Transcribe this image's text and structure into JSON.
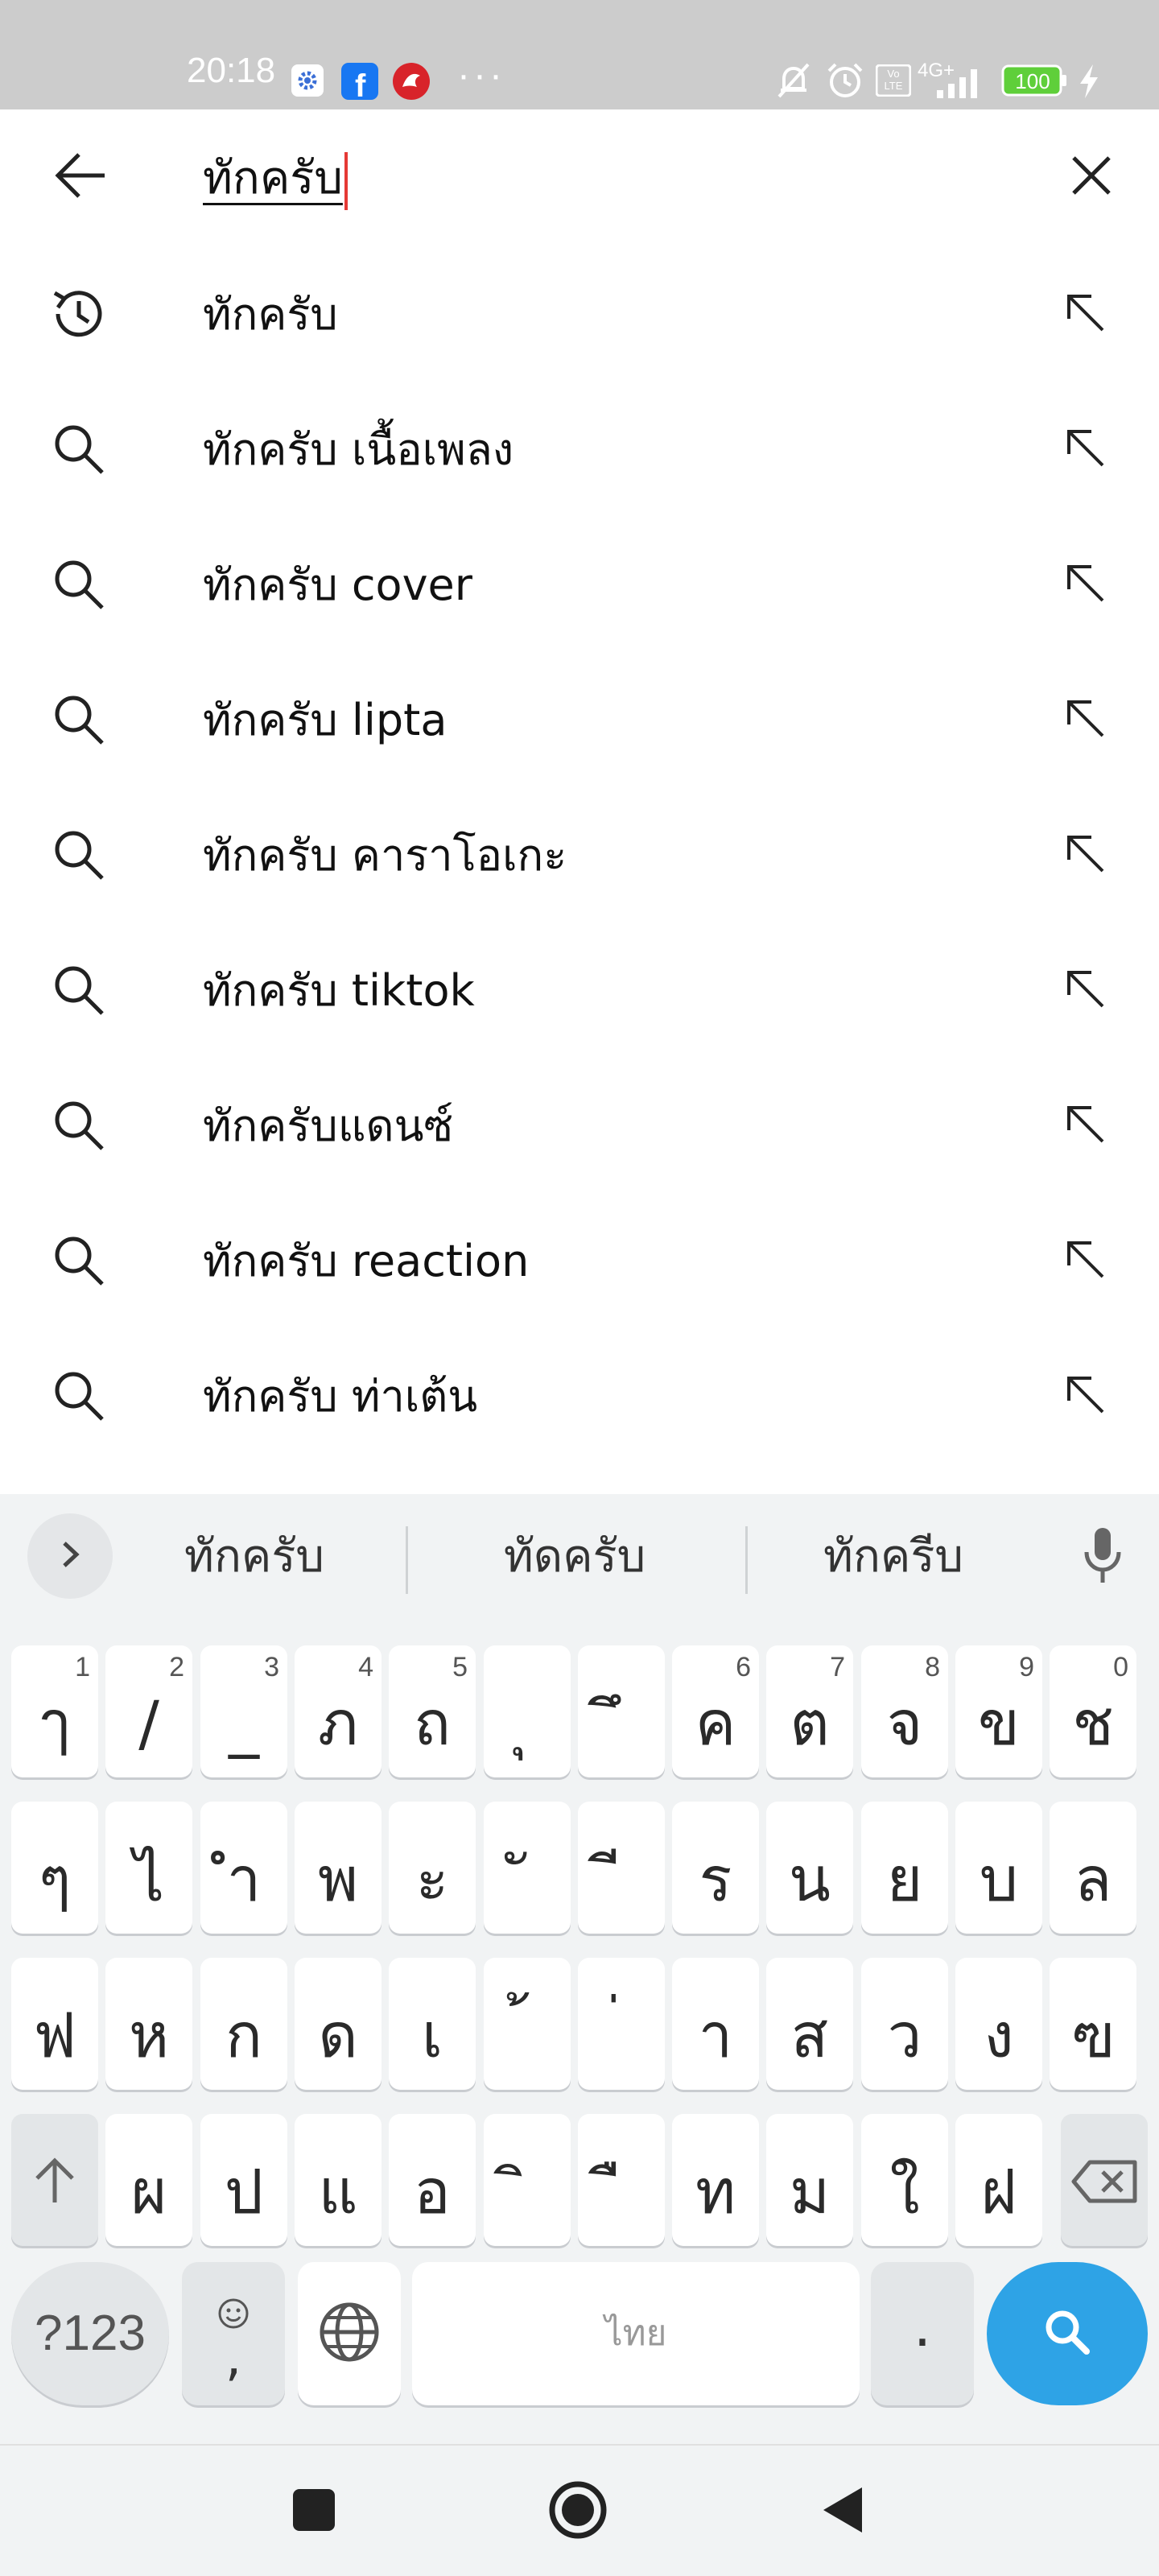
{
  "status_bar": {
    "time": "20:18",
    "network": "4G+",
    "volte": "Vo LTE",
    "battery": "100",
    "icons": [
      "settings-gear-icon",
      "facebook-icon",
      "phoenix-app-icon",
      "more-dots-icon",
      "bell-muted-icon",
      "alarm-icon",
      "signal-icon",
      "battery-icon",
      "charging-bolt-icon"
    ],
    "facebook_letter": "f",
    "dots": "···"
  },
  "search": {
    "query": "ทักครับ",
    "back_icon": "arrow-left-icon",
    "clear_icon": "close-icon"
  },
  "suggestions": [
    {
      "text": "ทักครับ",
      "icon": "history-icon"
    },
    {
      "text": "ทักครับ เนื้อเพลง",
      "icon": "search-icon"
    },
    {
      "text": "ทักครับ cover",
      "icon": "search-icon"
    },
    {
      "text": "ทักครับ lipta",
      "icon": "search-icon"
    },
    {
      "text": "ทักครับ คาราโอเกะ",
      "icon": "search-icon"
    },
    {
      "text": "ทักครับ tiktok",
      "icon": "search-icon"
    },
    {
      "text": "ทักครับแดนซ์",
      "icon": "search-icon"
    },
    {
      "text": "ทักครับ reaction",
      "icon": "search-icon"
    },
    {
      "text": "ทักครับ ท่าเต้น",
      "icon": "search-icon"
    }
  ],
  "keyboard": {
    "word_suggestions": [
      "ทักครับ",
      "ทัดครับ",
      "ทักครีบ"
    ],
    "row1": [
      {
        "k": "ๅ",
        "h": "1"
      },
      {
        "k": "/",
        "h": "2"
      },
      {
        "k": "_",
        "h": "3"
      },
      {
        "k": "ภ",
        "h": "4"
      },
      {
        "k": "ถ",
        "h": "5"
      },
      {
        "k": "ุ",
        "h": ""
      },
      {
        "k": "ึ",
        "h": ""
      },
      {
        "k": "ค",
        "h": "6"
      },
      {
        "k": "ต",
        "h": "7"
      },
      {
        "k": "จ",
        "h": "8"
      },
      {
        "k": "ข",
        "h": "9"
      },
      {
        "k": "ช",
        "h": "0"
      }
    ],
    "row2": [
      "ๆ",
      "ไ",
      "ำ",
      "พ",
      "ะ",
      "ั",
      "ี",
      "ร",
      "น",
      "ย",
      "บ",
      "ล"
    ],
    "row3": [
      "ฟ",
      "ห",
      "ก",
      "ด",
      "เ",
      "้",
      "่",
      "า",
      "ส",
      "ว",
      "ง",
      "ฃ"
    ],
    "row4": [
      "ผ",
      "ป",
      "แ",
      "อ",
      "ิ",
      "ื",
      "ท",
      "ม",
      "ใ",
      "ฝ"
    ],
    "symbols_label": "?123",
    "comma_label": ",",
    "space_label": "ไทย",
    "period_label": "."
  },
  "nav": {
    "icons": [
      "recents-square-icon",
      "home-circle-icon",
      "back-triangle-icon"
    ]
  }
}
